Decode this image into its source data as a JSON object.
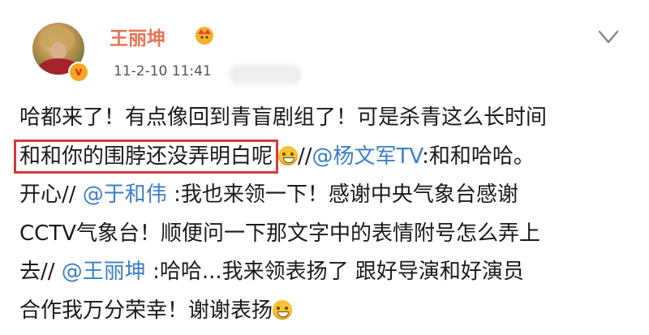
{
  "user": {
    "name": "王丽坤",
    "post_time": "11-2-10 11:41"
  },
  "post": {
    "line1": "哈都来了！有点像回到青盲剧组了！可是杀青这么长时间",
    "line2_highlight": "和和你的围脖还没弄明白呢",
    "line2_sep": "//",
    "line2_mention": "@杨文军TV",
    "line2_rest": ":和和哈哈。",
    "line3_prefix": "开心// ",
    "line3_mention": "@于和伟",
    "line3_rest": " :我也来领一下！感谢中央气象台感谢",
    "line4": "CCTV气象台！顺便问一下那文字中的表情附号怎么弄上",
    "line5_prefix": "去// ",
    "line5_mention": "@王丽坤",
    "line5_rest": " :哈哈...我来领表扬了    跟好导演和好演员",
    "line6": "合作我万分荣幸！谢谢表扬"
  },
  "icons": {
    "verified": "verified-badge-icon",
    "member": "member-crown-icon",
    "more": "chevron-down-icon",
    "emoji_think": "thinking-emoji-icon",
    "emoji_grin": "grin-emoji-icon"
  },
  "colors": {
    "username": "#eb7350",
    "mention": "#3b7fc4",
    "highlight_border": "#d63a3a"
  }
}
